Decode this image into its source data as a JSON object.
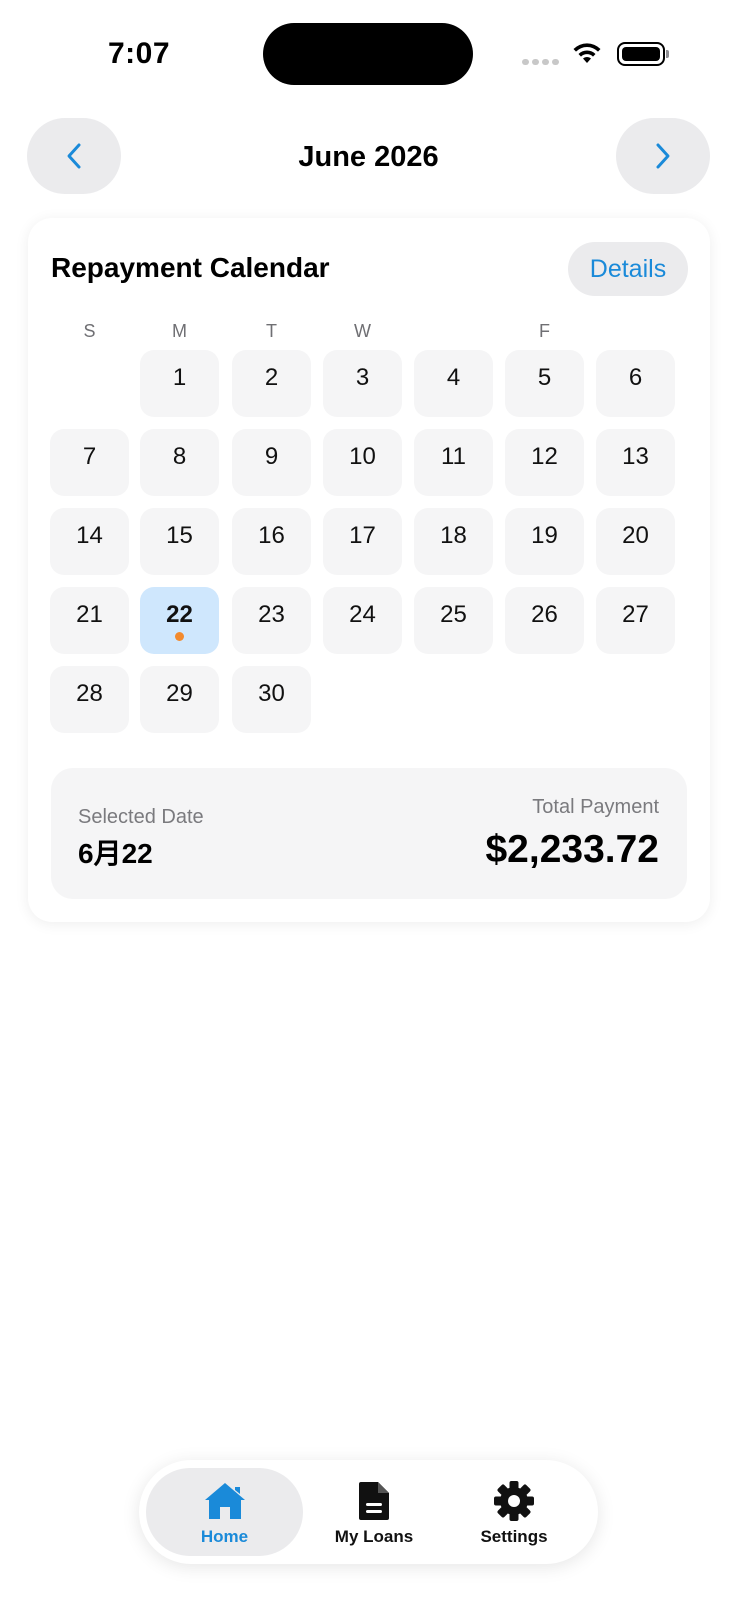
{
  "status_bar": {
    "time": "7:07"
  },
  "header": {
    "month_title": "June 2026",
    "prev_icon": "chevron-left-icon",
    "next_icon": "chevron-right-icon"
  },
  "calendar": {
    "title": "Repayment Calendar",
    "details_label": "Details",
    "weekdays": [
      "S",
      "M",
      "T",
      "W",
      "",
      "F",
      ""
    ],
    "days": [
      "1",
      "2",
      "3",
      "4",
      "5",
      "6",
      "7",
      "8",
      "9",
      "10",
      "11",
      "12",
      "13",
      "14",
      "15",
      "16",
      "17",
      "18",
      "19",
      "20",
      "21",
      "22",
      "23",
      "24",
      "25",
      "26",
      "27",
      "28",
      "29",
      "30"
    ],
    "selected_day": "22",
    "payment_marker_day": "22"
  },
  "summary": {
    "selected_label": "Selected Date",
    "selected_value": "6月22",
    "total_label": "Total Payment",
    "total_value": "$2,233.72"
  },
  "tabbar": {
    "tabs": [
      {
        "label": "Home",
        "icon": "home-icon",
        "active": true
      },
      {
        "label": "My Loans",
        "icon": "document-icon",
        "active": false
      },
      {
        "label": "Settings",
        "icon": "gear-icon",
        "active": false
      }
    ]
  },
  "colors": {
    "accent": "#1a8ad9",
    "marker": "#f28a2e",
    "selected_bg": "#cfe7fd"
  }
}
